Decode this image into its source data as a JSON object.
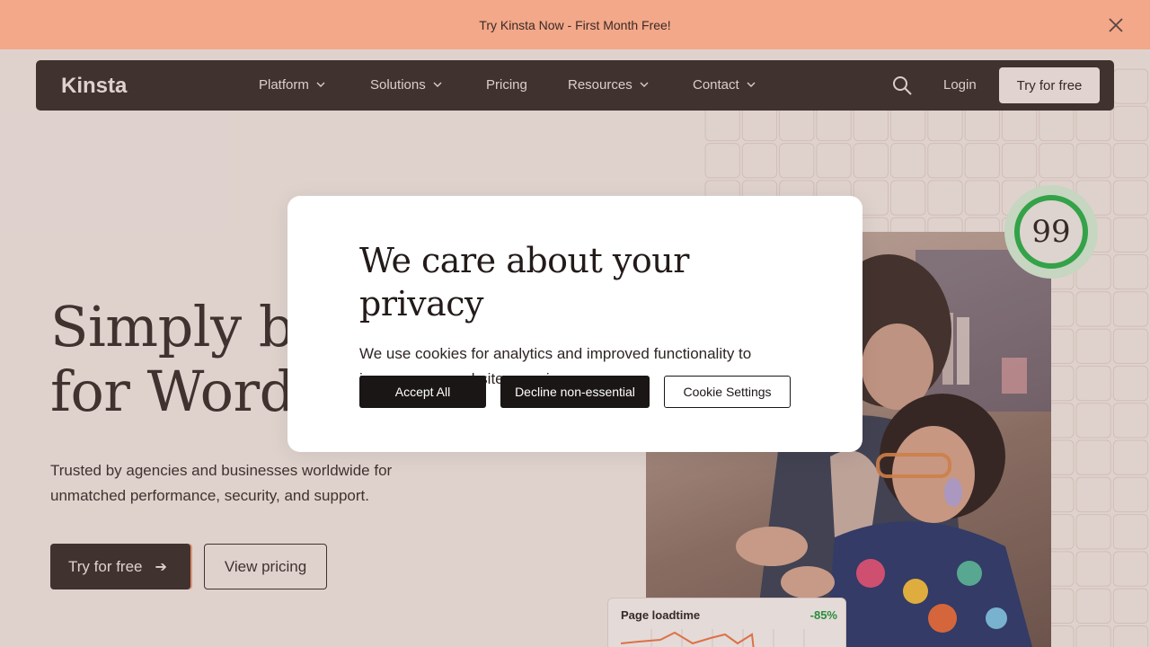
{
  "announcement": {
    "text": "Try Kinsta Now - First Month Free!",
    "close_icon": "close-icon"
  },
  "nav": {
    "logo_text": "Kinsta",
    "items": [
      {
        "label": "Platform",
        "has_dropdown": true
      },
      {
        "label": "Solutions",
        "has_dropdown": true
      },
      {
        "label": "Pricing",
        "has_dropdown": false
      },
      {
        "label": "Resources",
        "has_dropdown": true
      },
      {
        "label": "Contact",
        "has_dropdown": true
      }
    ],
    "search_icon": "search-icon",
    "login": "Login",
    "cta": "Try for free"
  },
  "hero": {
    "title_line1": "Simply be",
    "title_line2": "for WordP",
    "subtitle": "Trusted by agencies and businesses worldwide for unmatched performance, security, and support.",
    "primary_button": "Try for free",
    "primary_arrow": "➔",
    "secondary_button": "View pricing"
  },
  "score_badge": {
    "value": "99"
  },
  "loadtime_card": {
    "label": "Page loadtime",
    "value": "-85%"
  },
  "cookie_modal": {
    "title": "We care about your privacy",
    "body": "We use cookies for analytics and improved functionality to improve your website experience.",
    "accept": "Accept All",
    "decline": "Decline non-essential",
    "settings": "Cookie Settings"
  },
  "colors": {
    "announcement_bg": "#f2a889",
    "nav_bg": "#3a2f2d",
    "page_bg": "#f5ebe7",
    "accent_green": "#2bb34a",
    "loadtime_line": "#f07a4a"
  }
}
